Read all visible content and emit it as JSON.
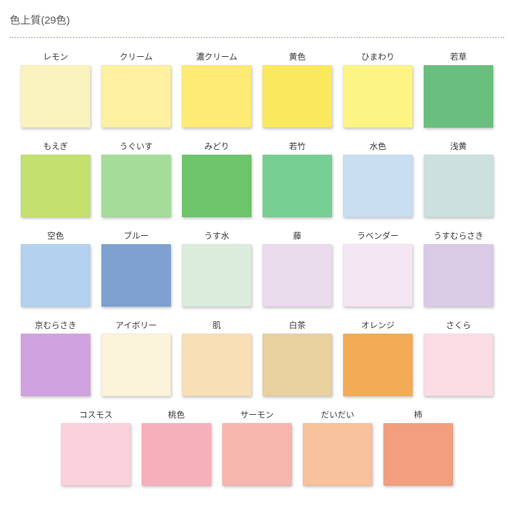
{
  "title": "色上質(29色)",
  "rows": [
    [
      {
        "name": "レモン",
        "color": "#fbf3bd"
      },
      {
        "name": "クリーム",
        "color": "#fdf0a0"
      },
      {
        "name": "濃クリーム",
        "color": "#fdeb76"
      },
      {
        "name": "黄色",
        "color": "#fae95d"
      },
      {
        "name": "ひまわり",
        "color": "#fcf584"
      },
      {
        "name": "若草",
        "color": "#6abf7f"
      }
    ],
    [
      {
        "name": "もえぎ",
        "color": "#c4e06e"
      },
      {
        "name": "うぐいす",
        "color": "#a6dc9a"
      },
      {
        "name": "みどり",
        "color": "#6ec46a"
      },
      {
        "name": "若竹",
        "color": "#78cf93"
      },
      {
        "name": "水色",
        "color": "#c9dff1"
      },
      {
        "name": "浅黄",
        "color": "#cce1de"
      }
    ],
    [
      {
        "name": "空色",
        "color": "#b4d2ef"
      },
      {
        "name": "ブルー",
        "color": "#7da0d1"
      },
      {
        "name": "うす水",
        "color": "#dcecdc"
      },
      {
        "name": "藤",
        "color": "#e9daec"
      },
      {
        "name": "ラベンダー",
        "color": "#f3e6f2"
      },
      {
        "name": "うすむらさき",
        "color": "#d9cbe6"
      }
    ],
    [
      {
        "name": "京むらさき",
        "color": "#d0a3e0"
      },
      {
        "name": "アイボリー",
        "color": "#fbf4da"
      },
      {
        "name": "肌",
        "color": "#f8dfb6"
      },
      {
        "name": "白茶",
        "color": "#e8d19e"
      },
      {
        "name": "オレンジ",
        "color": "#f2ac55"
      },
      {
        "name": "さくら",
        "color": "#fbdce5"
      }
    ],
    [
      {
        "name": "コスモス",
        "color": "#fad1dc"
      },
      {
        "name": "桃色",
        "color": "#f6b0bb"
      },
      {
        "name": "サーモン",
        "color": "#f5b6ae"
      },
      {
        "name": "だいだい",
        "color": "#f7c19b"
      },
      {
        "name": "柿",
        "color": "#f29e7f"
      }
    ]
  ]
}
